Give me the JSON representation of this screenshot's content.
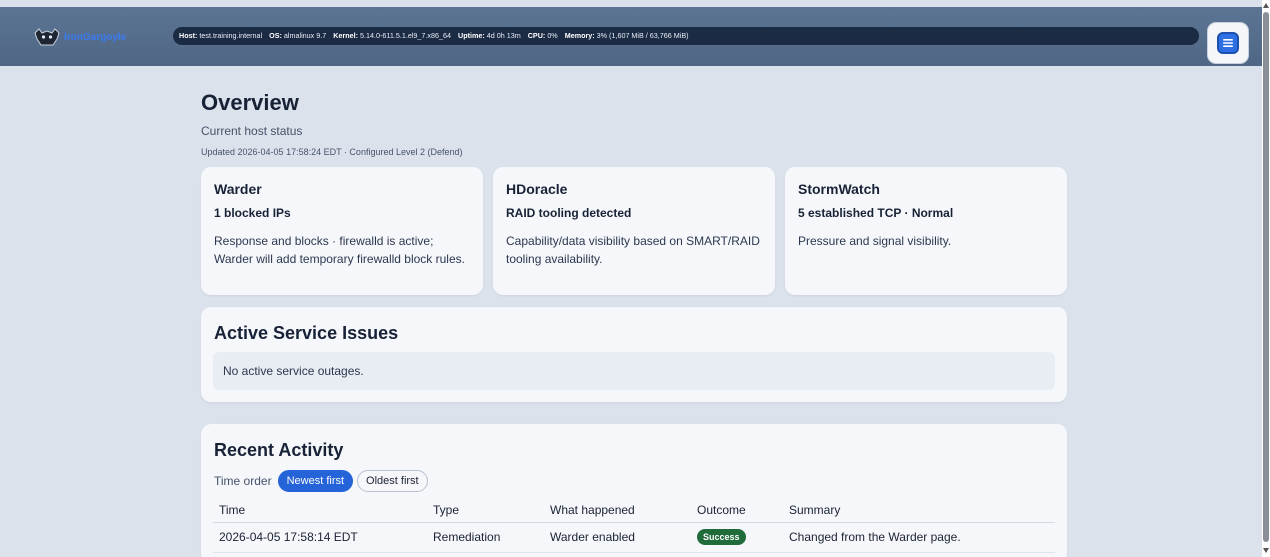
{
  "header": {
    "brand": "IronGargoyle",
    "status": [
      {
        "label": "Host:",
        "value": "test.training.internal"
      },
      {
        "label": "OS:",
        "value": "almalinux 9.7"
      },
      {
        "label": "Kernel:",
        "value": "5.14.0-611.5.1.el9_7.x86_64"
      },
      {
        "label": "Uptime:",
        "value": "4d 0h 13m"
      },
      {
        "label": "CPU:",
        "value": "0%"
      },
      {
        "label": "Memory:",
        "value": "3% (1,607 MiB / 63,766 MiB)"
      }
    ],
    "menu_icon": "menu-icon"
  },
  "page": {
    "title": "Overview",
    "subtitle": "Current host status",
    "updated": "Updated 2026-04-05 17:58:24 EDT · Configured Level 2 (Defend)"
  },
  "cards": [
    {
      "title": "Warder",
      "metric": "1 blocked IPs",
      "desc": "Response and blocks · firewalld is active; Warder will add temporary firewalld block rules."
    },
    {
      "title": "HDoracle",
      "metric": "RAID tooling detected",
      "desc": "Capability/data visibility based on SMART/RAID tooling availability."
    },
    {
      "title": "StormWatch",
      "metric": "5 established TCP · Normal",
      "desc": "Pressure and signal visibility."
    }
  ],
  "issues": {
    "title": "Active Service Issues",
    "empty": "No active service outages."
  },
  "activity": {
    "title": "Recent Activity",
    "order_label": "Time order",
    "newest": "Newest first",
    "oldest": "Oldest first",
    "columns": [
      "Time",
      "Type",
      "What happened",
      "Outcome",
      "Summary"
    ],
    "rows": [
      {
        "time": "2026-04-05 17:58:14 EDT",
        "type": "Remediation",
        "what": "Warder enabled",
        "outcome": "Success",
        "summary": "Changed from the Warder page."
      }
    ]
  },
  "colors": {
    "accent": "#2563d8",
    "success": "#1f6b3a",
    "status_bar": "#1c2b44",
    "header": "#56708f"
  }
}
